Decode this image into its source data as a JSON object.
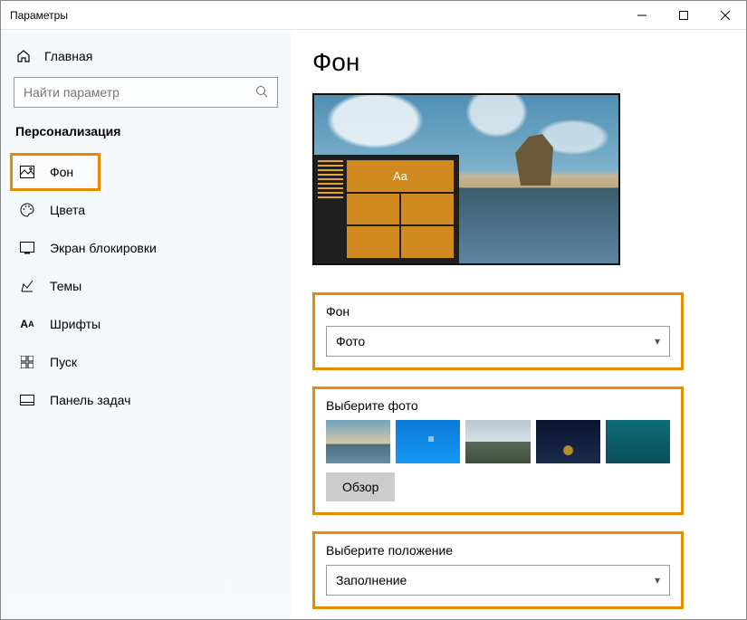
{
  "window": {
    "title": "Параметры"
  },
  "sidebar": {
    "home": "Главная",
    "search_placeholder": "Найти параметр",
    "section": "Персонализация",
    "items": [
      {
        "label": "Фон"
      },
      {
        "label": "Цвета"
      },
      {
        "label": "Экран блокировки"
      },
      {
        "label": "Темы"
      },
      {
        "label": "Шрифты"
      },
      {
        "label": "Пуск"
      },
      {
        "label": "Панель задач"
      }
    ]
  },
  "main": {
    "heading": "Фон",
    "preview_sample": "Aa",
    "background": {
      "label": "Фон",
      "value": "Фото"
    },
    "choose_photo": {
      "label": "Выберите фото",
      "browse": "Обзор"
    },
    "fit": {
      "label": "Выберите положение",
      "value": "Заполнение"
    }
  }
}
